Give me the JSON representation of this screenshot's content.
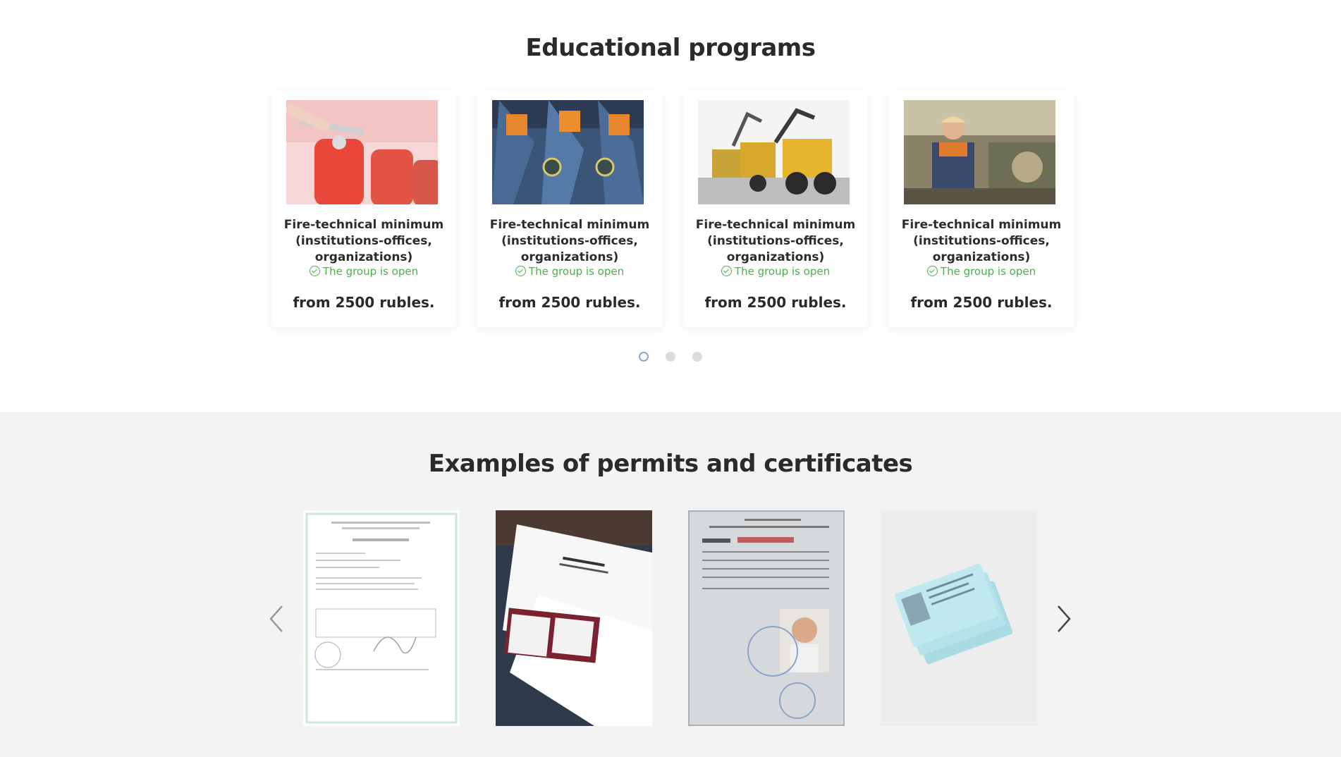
{
  "programs": {
    "title": "Educational programs",
    "cards": [
      {
        "image": "fire-extinguishers-image",
        "title": "Fire-technical minimum (institutions-offices, organizations)",
        "status": "The group is open",
        "price": "from 2500 rubles."
      },
      {
        "image": "rescue-uniforms-image",
        "title": "Fire-technical minimum (institutions-offices, organizations)",
        "status": "The group is open",
        "price": "from 2500 rubles."
      },
      {
        "image": "excavators-image",
        "title": "Fire-technical minimum (institutions-offices, organizations)",
        "status": "The group is open",
        "price": "from 2500 rubles."
      },
      {
        "image": "factory-worker-image",
        "title": "Fire-technical minimum (institutions-offices, organizations)",
        "status": "The group is open",
        "price": "from 2500 rubles."
      }
    ],
    "pagination": {
      "pages": 3,
      "active": 1
    }
  },
  "permits": {
    "title": "Examples of permits and certificates",
    "documents": [
      {
        "image": "protocol-document-image"
      },
      {
        "image": "safety-journal-image"
      },
      {
        "image": "tractor-driver-certificate-image"
      },
      {
        "image": "blue-permit-cards-image"
      }
    ],
    "prev_icon": "chevron-left-icon",
    "next_icon": "chevron-right-icon"
  },
  "colors": {
    "status_green": "#4ab04a",
    "active_dot": "#8aa6d8",
    "section_bg": "#f3f3f3"
  }
}
